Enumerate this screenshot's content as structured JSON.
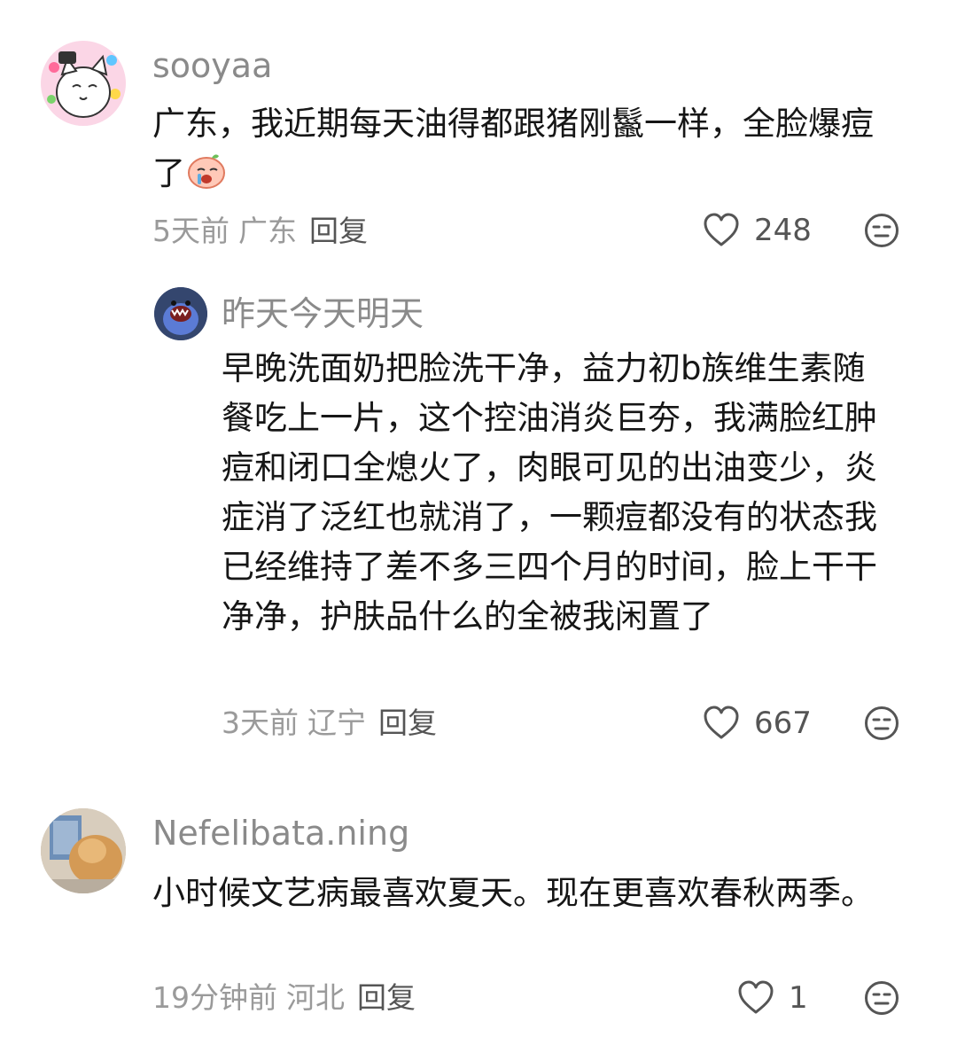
{
  "comments": [
    {
      "username": "sooyaa",
      "text": "广东，我近期每天油得都跟猪刚鬣一样，全脸爆痘了",
      "emoji": "crying-sticker",
      "time": "5天前",
      "location": "广东",
      "reply_label": "回复",
      "likes": "248",
      "avatar": "cartoon-cat-avatar"
    },
    {
      "username": "昨天今天明天",
      "text": "早晚洗面奶把脸洗干净，益力初b族维生素随餐吃上一片，这个控油消炎巨夯，我满脸红肿痘和闭口全熄火了，肉眼可见的出油变少，炎症消了泛红也就消了，一颗痘都没有的状态我已经维持了差不多三四个月的时间，脸上干干净净，护肤品什么的全被我闲置了",
      "time": "3天前",
      "location": "辽宁",
      "reply_label": "回复",
      "likes": "667",
      "avatar": "blue-monster-avatar"
    },
    {
      "username": "Nefelibata.ning",
      "text": "小时候文艺病最喜欢夏天。现在更喜欢春秋两季。",
      "time": "19分钟前",
      "location": "河北",
      "reply_label": "回复",
      "likes": "1",
      "avatar": "cat-photo-avatar"
    }
  ],
  "icons": {
    "like": "heart-outline-icon",
    "dislike": "meh-face-icon"
  },
  "colors": {
    "username": "#8a8a8a",
    "text": "#161616",
    "meta": "#9a9a9a"
  }
}
